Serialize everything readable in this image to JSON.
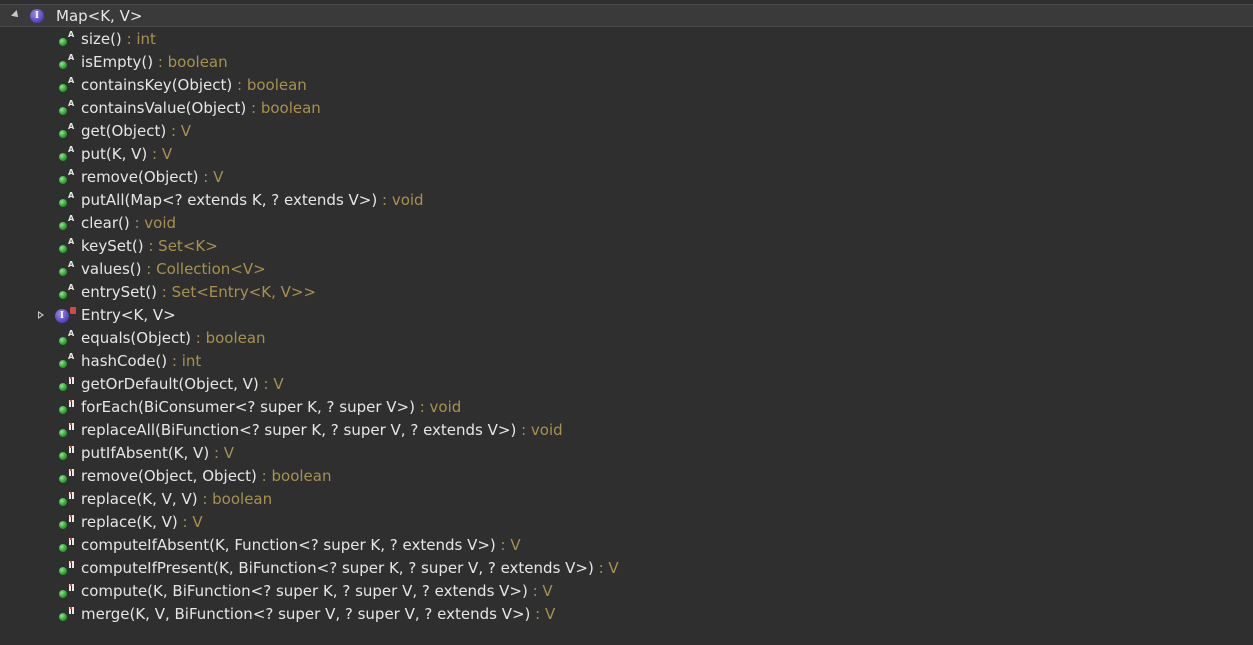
{
  "root": {
    "name": "Map<K, V>",
    "icon": "interface-icon",
    "icon_letter": "I"
  },
  "members": [
    {
      "name": "size()",
      "type": " : int",
      "kind": "abstract"
    },
    {
      "name": "isEmpty()",
      "type": " : boolean",
      "kind": "abstract"
    },
    {
      "name": "containsKey(Object)",
      "type": " : boolean",
      "kind": "abstract"
    },
    {
      "name": "containsValue(Object)",
      "type": " : boolean",
      "kind": "abstract"
    },
    {
      "name": "get(Object)",
      "type": " : V",
      "kind": "abstract"
    },
    {
      "name": "put(K, V)",
      "type": " : V",
      "kind": "abstract"
    },
    {
      "name": "remove(Object)",
      "type": " : V",
      "kind": "abstract"
    },
    {
      "name": "putAll(Map<? extends K, ? extends V>)",
      "type": " : void",
      "kind": "abstract"
    },
    {
      "name": "clear()",
      "type": " : void",
      "kind": "abstract"
    },
    {
      "name": "keySet()",
      "type": " : Set<K>",
      "kind": "abstract"
    },
    {
      "name": "values()",
      "type": " : Collection<V>",
      "kind": "abstract"
    },
    {
      "name": "entrySet()",
      "type": " : Set<Entry<K, V>>",
      "kind": "abstract"
    },
    {
      "name": "Entry<K, V>",
      "type": "",
      "kind": "interface"
    },
    {
      "name": "equals(Object)",
      "type": " : boolean",
      "kind": "abstract"
    },
    {
      "name": "hashCode()",
      "type": " : int",
      "kind": "abstract"
    },
    {
      "name": "getOrDefault(Object, V)",
      "type": " : V",
      "kind": "default"
    },
    {
      "name": "forEach(BiConsumer<? super K, ? super V>)",
      "type": " : void",
      "kind": "default"
    },
    {
      "name": "replaceAll(BiFunction<? super K, ? super V, ? extends V>)",
      "type": " : void",
      "kind": "default"
    },
    {
      "name": "putIfAbsent(K, V)",
      "type": " : V",
      "kind": "default"
    },
    {
      "name": "remove(Object, Object)",
      "type": " : boolean",
      "kind": "default"
    },
    {
      "name": "replace(K, V, V)",
      "type": " : boolean",
      "kind": "default"
    },
    {
      "name": "replace(K, V)",
      "type": " : V",
      "kind": "default"
    },
    {
      "name": "computeIfAbsent(K, Function<? super K, ? extends V>)",
      "type": " : V",
      "kind": "default"
    },
    {
      "name": "computeIfPresent(K, BiFunction<? super K, ? super V, ? extends V>)",
      "type": " : V",
      "kind": "default"
    },
    {
      "name": "compute(K, BiFunction<? super K, ? super V, ? extends V>)",
      "type": " : V",
      "kind": "default"
    },
    {
      "name": "merge(K, V, BiFunction<? super V, ? super V, ? extends V>)",
      "type": " : V",
      "kind": "default"
    }
  ],
  "colors": {
    "background": "#2f2f2f",
    "member_text": "#e6e6e6",
    "return_type": "#a8914e",
    "method_icon": "#2fa52f",
    "interface_icon": "#5b49c2"
  }
}
